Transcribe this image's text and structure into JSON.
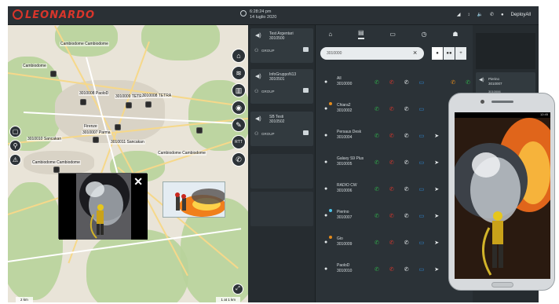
{
  "app": {
    "brand": "LEONARDO"
  },
  "header": {
    "time": "6:28:24 pm",
    "date": "14 luglio 2020",
    "user": "DeployAll"
  },
  "map": {
    "labels": [
      "Cambiodome Cambiodome",
      "Cambiodome",
      "3010009 TETRA",
      "3010008 PaoloD",
      "3010007 Parma",
      "3010010 Sancakan",
      "3010011 Sancakan",
      "Cambiodome Cambiodome",
      "Cambiodome Cambiodome",
      "Firenze",
      "3010008 TETRA"
    ],
    "scale_left": "2 km",
    "scale_right": "1 at  1 km",
    "right_tools": [
      "home-icon",
      "layers-icon",
      "buildings-icon",
      "location-pin-icon",
      "tools-icon",
      "rtt-icon",
      "phone-icon"
    ],
    "left_tools": [
      "chat-icon",
      "search-icon",
      "warning-icon"
    ],
    "rtt_label": "RTT"
  },
  "groups": [
    {
      "name": "Test Argentari",
      "id": "3010500",
      "type": "GROUP"
    },
    {
      "name": "InfoGruppoN13",
      "id": "3010501",
      "type": "GROUP"
    },
    {
      "name": "SB Testi",
      "id": "3010502",
      "type": "GROUP"
    }
  ],
  "contacts_panel": {
    "tabs": [
      "home-icon",
      "contacts-icon",
      "chat-icon",
      "history-icon",
      "settings-icon"
    ],
    "search_value": "3010000",
    "rows": [
      {
        "name": "All",
        "id": "3010000",
        "status": "",
        "extra": true
      },
      {
        "name": "Chiara2",
        "id": "3010002",
        "status": "#e38b1c",
        "extra": false
      },
      {
        "name": "Persaus Desk",
        "id": "3010004",
        "status": "",
        "extra": false
      },
      {
        "name": "Galaxy S9 Plus",
        "id": "3010005",
        "status": "",
        "extra": false
      },
      {
        "name": "RADIO CW",
        "id": "3010006",
        "status": "",
        "extra": false
      },
      {
        "name": "Pierino",
        "id": "3010007",
        "status": "#4fc3e8",
        "extra": false
      },
      {
        "name": "Gio",
        "id": "3010009",
        "status": "#e38b1c",
        "extra": true
      },
      {
        "name": "PaoloD",
        "id": "3010010",
        "status": "",
        "extra": false
      }
    ]
  },
  "right_panel": {
    "name": "Pierino",
    "id": "3010007",
    "status_label": "3010006"
  },
  "phone": {
    "status_time": "12:45"
  },
  "colors": {
    "call_green": "#2faa4a",
    "call_red": "#d6362c",
    "msg_blue": "#2d8bd9",
    "brand_red": "#d9352b"
  }
}
